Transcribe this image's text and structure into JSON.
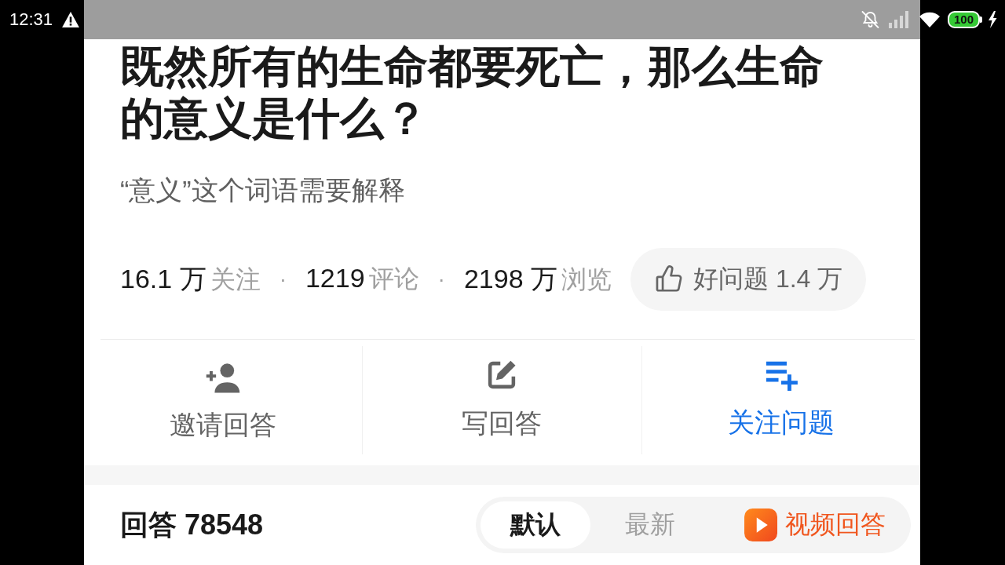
{
  "status_bar": {
    "time": "12:31",
    "battery": "100"
  },
  "question": {
    "title": "既然所有的生命都要死亡，那么生命的意义是什么？",
    "description": "“意义”这个词语需要解释",
    "stats": [
      {
        "value": "16.1 万",
        "label": "关注"
      },
      {
        "separator": "·",
        "value": "1219",
        "label": "评论"
      },
      {
        "separator": "·",
        "value": "2198 万",
        "label": "浏览"
      }
    ],
    "good_question_button": {
      "label": "好问题 1.4 万"
    }
  },
  "actions": [
    {
      "kind": "invite",
      "label": "邀请回答",
      "highlighted": false
    },
    {
      "kind": "write",
      "label": "写回答",
      "highlighted": false
    },
    {
      "kind": "follow",
      "label": "关注问题",
      "highlighted": true
    }
  ],
  "answers": {
    "title": "回答 78548",
    "sort_tabs": [
      {
        "label": "默认",
        "selected": true
      },
      {
        "label": "最新",
        "selected": false
      }
    ],
    "video_answer_button": {
      "label": "视频回答"
    }
  }
}
